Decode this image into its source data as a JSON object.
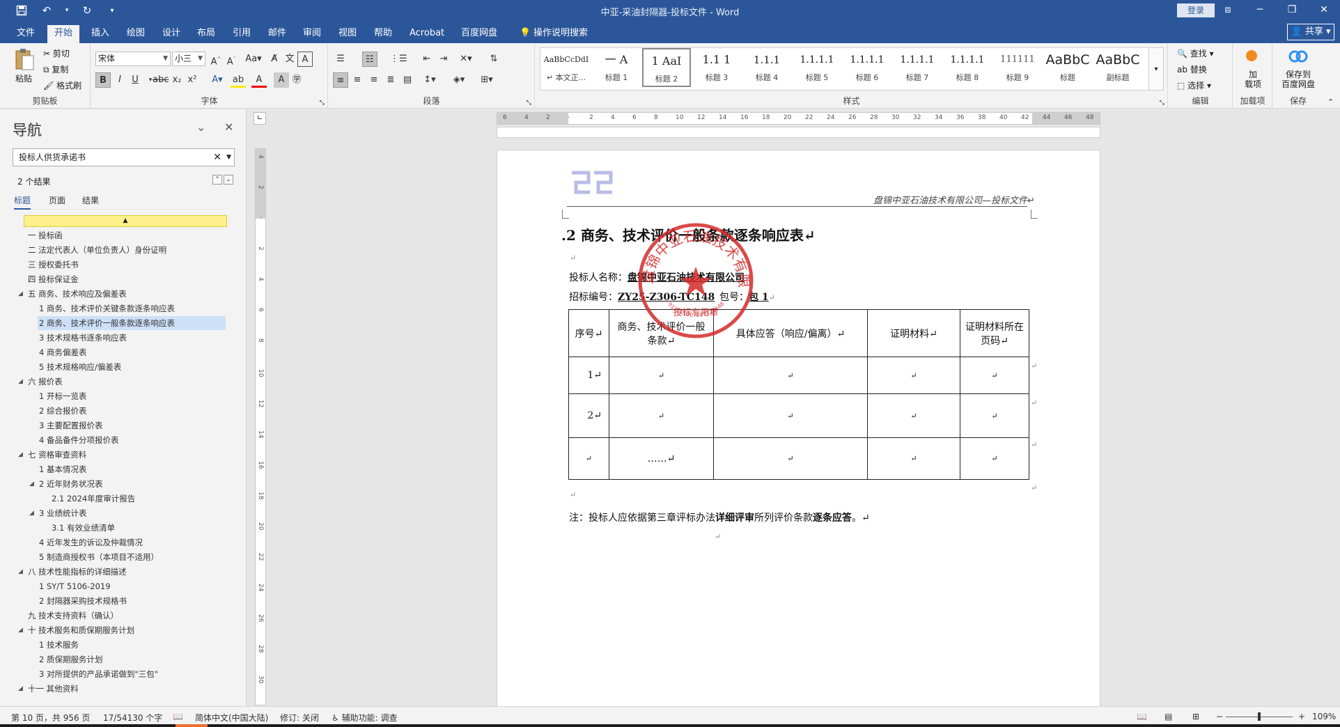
{
  "app": {
    "doc_title": "中亚-采油封隔器-投标文件  -  Word",
    "login_label": "登录",
    "share_label": "共享"
  },
  "tabs": [
    "文件",
    "开始",
    "插入",
    "绘图",
    "设计",
    "布局",
    "引用",
    "邮件",
    "审阅",
    "视图",
    "帮助",
    "Acrobat",
    "百度网盘"
  ],
  "tell_me": "操作说明搜索",
  "ribbon": {
    "clipboard": {
      "paste": "粘贴",
      "cut": "剪切",
      "copy": "复制",
      "format_painter": "格式刷",
      "label": "剪贴板"
    },
    "font": {
      "font_name": "宋体",
      "font_size": "小三",
      "label": "字体"
    },
    "paragraph": {
      "label": "段落"
    },
    "styles": {
      "label": "样式",
      "items": [
        {
          "sample": "AaBbCcDdI",
          "name": "↵ 本文正..."
        },
        {
          "sample": "一 A",
          "name": "标题 1"
        },
        {
          "sample": "1 AaI",
          "name": "标题 2"
        },
        {
          "sample": "1.1 1",
          "name": "标题 3"
        },
        {
          "sample": "1.1.1",
          "name": "标题 4"
        },
        {
          "sample": "1.1.1.1",
          "name": "标题 5"
        },
        {
          "sample": "1.1.1.1",
          "name": "标题 6"
        },
        {
          "sample": "1.1.1.1",
          "name": "标题 7"
        },
        {
          "sample": "1.1.1.1",
          "name": "标题 8"
        },
        {
          "sample": "111111",
          "name": "标题 9"
        },
        {
          "sample": "AaBbC",
          "name": "标题"
        },
        {
          "sample": "AaBbC",
          "name": "副标题"
        }
      ]
    },
    "editing": {
      "find": "查找",
      "replace": "替换",
      "select": "选择",
      "label": "编辑"
    },
    "addins": {
      "btn": "加\n载项",
      "label": "加载项"
    },
    "save": {
      "btn": "保存到\n百度网盘",
      "label": "保存"
    }
  },
  "nav": {
    "title": "导航",
    "search_value": "投标人供货承诺书",
    "results": "2 个结果",
    "tabs": [
      "标题",
      "页面",
      "结果"
    ],
    "items": [
      {
        "text": "一 投标函",
        "level": 1,
        "tri": false
      },
      {
        "text": "二 法定代表人（单位负责人）身份证明",
        "level": 1,
        "tri": false
      },
      {
        "text": "三 授权委托书",
        "level": 1,
        "tri": false
      },
      {
        "text": "四 投标保证金",
        "level": 1,
        "tri": false
      },
      {
        "text": "五 商务、技术响应及偏差表",
        "level": 1,
        "tri": true
      },
      {
        "text": "1 商务、技术评价关键条款逐条响应表",
        "level": 2,
        "tri": false
      },
      {
        "text": "2 商务、技术评价一般条款逐条响应表",
        "level": 2,
        "tri": false,
        "selected": true
      },
      {
        "text": "3 技术规格书逐条响应表",
        "level": 2,
        "tri": false
      },
      {
        "text": "4 商务偏差表",
        "level": 2,
        "tri": false
      },
      {
        "text": "5 技术规格响应/偏差表",
        "level": 2,
        "tri": false
      },
      {
        "text": "六 报价表",
        "level": 1,
        "tri": true
      },
      {
        "text": "1 开标一览表",
        "level": 2,
        "tri": false
      },
      {
        "text": "2 综合报价表",
        "level": 2,
        "tri": false
      },
      {
        "text": "3 主要配置报价表",
        "level": 2,
        "tri": false
      },
      {
        "text": "4 备品备件分项报价表",
        "level": 2,
        "tri": false
      },
      {
        "text": "七 资格审查资料",
        "level": 1,
        "tri": true
      },
      {
        "text": "1 基本情况表",
        "level": 2,
        "tri": false
      },
      {
        "text": "2 近年财务状况表",
        "level": 2,
        "tri": true
      },
      {
        "text": "2.1 2024年度审计报告",
        "level": 3,
        "tri": false
      },
      {
        "text": "3 业绩统计表",
        "level": 2,
        "tri": true
      },
      {
        "text": "3.1 有效业绩清单",
        "level": 3,
        "tri": false
      },
      {
        "text": "4 近年发生的诉讼及仲裁情况",
        "level": 2,
        "tri": false
      },
      {
        "text": "5 制造商授权书（本项目不适用）",
        "level": 2,
        "tri": false
      },
      {
        "text": "八 技术性能指标的详细描述",
        "level": 1,
        "tri": true
      },
      {
        "text": "1 SY/T 5106-2019",
        "level": 2,
        "tri": false
      },
      {
        "text": "2 封隔器采购技术规格书",
        "level": 2,
        "tri": false
      },
      {
        "text": "九 技术支持资料（确认）",
        "level": 1,
        "tri": false
      },
      {
        "text": "十 技术服务和质保期服务计划",
        "level": 1,
        "tri": true
      },
      {
        "text": "1 技术服务",
        "level": 2,
        "tri": false
      },
      {
        "text": "2 质保期服务计划",
        "level": 2,
        "tri": false
      },
      {
        "text": "3 对所提供的产品承诺做到\"三包\"",
        "level": 2,
        "tri": false
      },
      {
        "text": "十一 其他资料",
        "level": 1,
        "tri": true
      }
    ]
  },
  "ruler_ticks": [
    "6",
    "4",
    "2",
    "",
    "2",
    "4",
    "6",
    "8",
    "10",
    "12",
    "14",
    "16",
    "18",
    "20",
    "22",
    "24",
    "26",
    "28",
    "30",
    "32",
    "34",
    "36",
    "38",
    "40",
    "42",
    "44",
    "46",
    "48"
  ],
  "vruler_ticks": [
    "4",
    "2",
    "",
    "2",
    "4",
    "6",
    "8",
    "10",
    "12",
    "14",
    "16",
    "18",
    "20",
    "22",
    "24",
    "26",
    "28",
    "30"
  ],
  "document": {
    "header_text": "盘锦中亚石油技术有限公司—投标文件↵",
    "heading": ".2 商务、技术评价一般条款逐条响应表↵",
    "bidder_label": "投标人名称：",
    "bidder_name": "盘锦中亚石油技术有限公司",
    "tender_label": "招标编号：",
    "tender_no": "ZY25-Z306-TC148",
    "package_label": "包号：",
    "package_no": "包 1",
    "stamp_text": "盘锦中亚石油技术有限公司",
    "stamp_code": "912111007391128648",
    "stamp_sub": "投标专用章",
    "table_headers": [
      "序号↵",
      "商务、技术评价一般条款↵",
      "具体应答（响应/偏离）↵",
      "证明材料↵",
      "证明材料所在页码↵"
    ],
    "table_rows": [
      [
        "1↵",
        "↵",
        "↵",
        "↵",
        "↵"
      ],
      [
        "2↵",
        "↵",
        "↵",
        "↵",
        "↵"
      ],
      [
        "↵",
        "……↵",
        "↵",
        "↵",
        "↵"
      ]
    ],
    "note_prefix": "注：投标人应依据第三章评标办法",
    "note_bold1": "详细评审",
    "note_mid": "所列评价条款",
    "note_bold2": "逐条应答",
    "note_end": "。↵",
    "pilcrow": "↵"
  },
  "status": {
    "page": "第 10 页，共 956 页",
    "words": "17/54130 个字",
    "lang": "简体中文(中国大陆)",
    "track": "修订: 关闭",
    "access": "辅助功能: 调查",
    "zoom": "109%"
  },
  "colors": {
    "accent": "#2b579a",
    "stamp": "#d42a2a",
    "highlight": "#fff08c"
  }
}
